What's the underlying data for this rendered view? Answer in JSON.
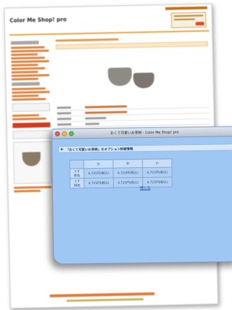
{
  "store_page": {
    "logo": "Color Me Shop! pro"
  },
  "popup": {
    "window_title": "おくて可愛いお茶碗 - Color Me Shop! pro",
    "option_heading": "「おくて可愛いお茶碗」のオプション詳細情報",
    "columns": [
      "大",
      "中",
      "小"
    ],
    "rows": [
      {
        "label": "うす茶色",
        "cells": [
          "4,725円(税込)",
          "4,725円(税込)",
          "4,725円(税込)"
        ]
      },
      {
        "label": "うす緑色",
        "cells": [
          "4,725円(税込)",
          "4,725円(税込)",
          "4,725円(税込)"
        ]
      }
    ],
    "close_label": "閉じる"
  },
  "colors": {
    "accent": "#e9a441",
    "popup_bg": "#9fc7f3",
    "link": "#1a4fae"
  }
}
